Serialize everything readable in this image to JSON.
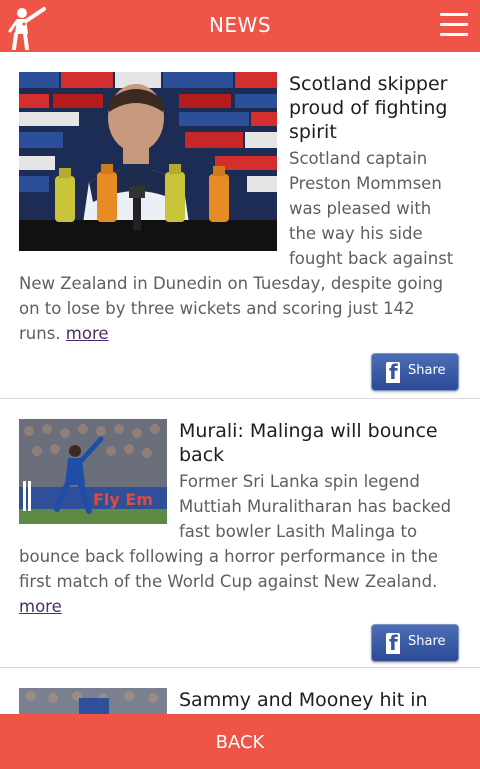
{
  "header": {
    "title": "NEWS"
  },
  "icons": {
    "logo": "cricket-player-logo",
    "menu": "hamburger-menu-icon",
    "share": "facebook-icon"
  },
  "articles": [
    {
      "title": "Scotland skipper proud of fighting spirit",
      "summary": "Scotland captain Preston Mommsen was pleased with the way his side fought back against New Zealand in Dunedin on Tuesday, despite going on to lose by three wickets and scoring just 142 runs.",
      "more": "more",
      "share": "Share"
    },
    {
      "title": "Murali: Malinga will bounce back",
      "summary": "Former Sri Lanka spin legend Muttiah Muralitharan has backed fast bowler Lasith Malinga to bounce back following a horror performance in the first match of the World Cup against New Zealand.",
      "more": "more",
      "share": "Share"
    },
    {
      "title": "Sammy and Mooney hit in"
    }
  ],
  "footer": {
    "back": "BACK"
  },
  "colors": {
    "accent": "#ef5446",
    "facebook": "#3b5998"
  }
}
